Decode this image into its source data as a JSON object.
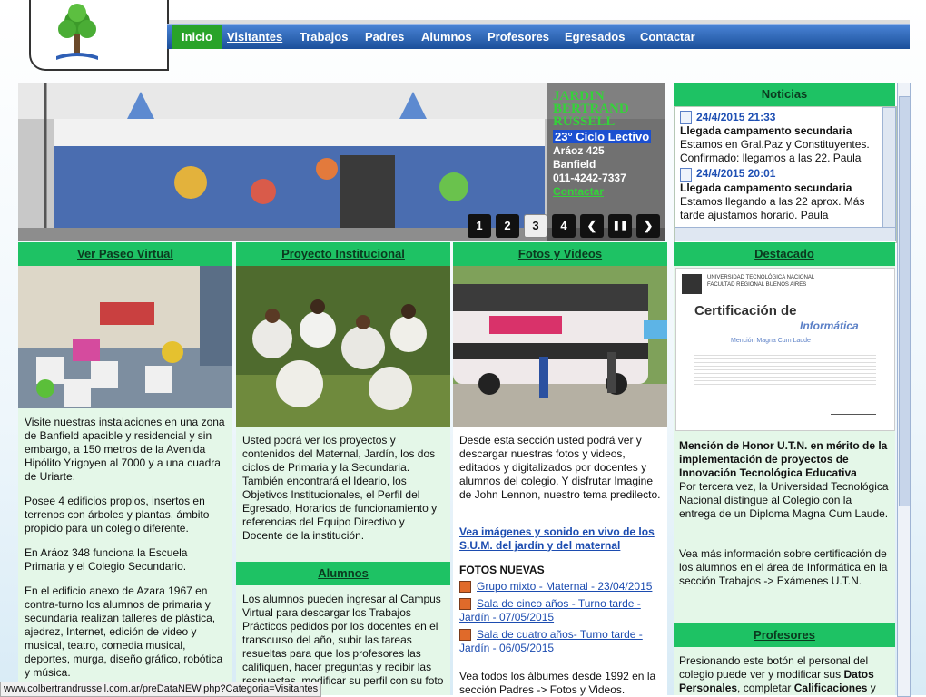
{
  "nav": {
    "items": [
      "Inicio",
      "Visitantes",
      "Trabajos",
      "Padres",
      "Alumnos",
      "Profesores",
      "Egresados",
      "Contactar"
    ]
  },
  "slider": {
    "school_name": "JARDIN BERTRAND RUSSELL",
    "cycle": "23° Ciclo Lectivo",
    "address": "Aráoz 425",
    "city": "Banfield",
    "phone": "011-4242-7337",
    "contact": "Contactar",
    "buttons": [
      "1",
      "2",
      "3",
      "4"
    ],
    "active_button": "3",
    "prev": "❮",
    "pause": "❚❚",
    "next": "❯"
  },
  "noticias": {
    "title": "Noticias",
    "items": [
      {
        "date": "24/4/2015 21:33",
        "headline": "Llegada campamento secundaria",
        "text": "Estamos en Gral.Paz y Constituyentes. Confirmado: llegamos a las 22. Paula"
      },
      {
        "date": "24/4/2015 20:01",
        "headline": "Llegada campamento secundaria",
        "text": "Estamos llegando a las 22 aprox. Más tarde ajustamos horario. Paula"
      }
    ]
  },
  "col1": {
    "title": "Ver Paseo Virtual",
    "paragraphs": [
      "Visite nuestras instalaciones en una zona de Banfield apacible y residencial y sin embargo, a 150 metros de la Avenida Hipólito Yrigoyen al 7000 y a una cuadra de Uriarte.",
      "Posee 4 edificios propios, insertos en terrenos con árboles y plantas, ámbito propicio para un colegio diferente.",
      "En Aráoz 348 funciona la Escuela Primaria y el Colegio Secundario.",
      "En el edificio anexo de Azara 1967  en contra-turno los alumnos de primaria y secundaria realizan talleres de plástica, ajedrez, Internet, edición de video y musical, teatro, comedia musical, deportes, murga, diseño gráfico, robótica y música."
    ]
  },
  "col2": {
    "title": "Proyecto Institucional",
    "text": "Usted podrá ver los proyectos y contenidos del Maternal, Jardín, los dos ciclos de Primaria y la Secundaria. También encontrará el Ideario, los Objetivos Institucionales, el Perfil del Egresado, Horarios de funcionamiento y referencias del Equipo Directivo y Docente de la institución.",
    "alumnos_title": "Alumnos",
    "alumnos_text": "Los alumnos pueden ingresar al Campus Virtual para descargar los Trabajos Prácticos pedidos por los docentes en el transcurso del año, subir las tareas resueltas para que los profesores las califiquen, hacer preguntas y recibir las respuestas, modificar su perfil con su foto"
  },
  "col3": {
    "title": "Fotos y Videos",
    "text": "Desde esta sección usted podrá ver y descargar nuestras fotos y videos, editados y digitalizados por docentes y alumnos del colegio. Y disfrutar Imagine de John Lennon, nuestro tema predilecto.",
    "video_link": "Vea imágenes y sonido en vivo de los S.U.M. del jardín y del maternal",
    "fotos_title": "FOTOS NUEVAS",
    "fotos": [
      "Grupo mixto - Maternal - 23/04/2015",
      "Sala de cinco años - Turno tarde - Jardín - 07/05/2015",
      "Sala de cuatro años- Turno tarde - Jardín - 06/05/2015"
    ],
    "footer_text": "Vea todos los álbumes desde 1992 en la sección Padres -> Fotos y Videos."
  },
  "col4": {
    "title": "Destacado",
    "cert": {
      "line1": "UNIVERSIDAD TECNOLÓGICA NACIONAL",
      "line2": "FACULTAD REGIONAL BUENOS AIRES",
      "title": "Certificación de",
      "subtitle": "Informática",
      "honor": "Mención Magna Cum Laude"
    },
    "bold": "Mención de Honor U.T.N. en mérito de la implementación de proyectos de Innovación Tecnológica Educativa",
    "text": "Por tercera vez, la Universidad Tecnológica Nacional distingue al Colegio con la entrega de un Diploma Magna Cum Laude.",
    "text2": "Vea más información sobre certificación de los alumnos en el área de Informática en la sección Trabajos -> Exámenes U.T.N.",
    "prof_title": "Profesores",
    "prof_text_a": "Presionando este botón el personal del colegio puede ver y modificar sus ",
    "prof_bold_a": "Datos Personales",
    "prof_text_b": ", completar ",
    "prof_bold_b": "Calificaciones",
    "prof_text_c": " y"
  },
  "status_bar": "www.colbertrandrussell.com.ar/preDataNEW.php?Categoria=Visitantes"
}
